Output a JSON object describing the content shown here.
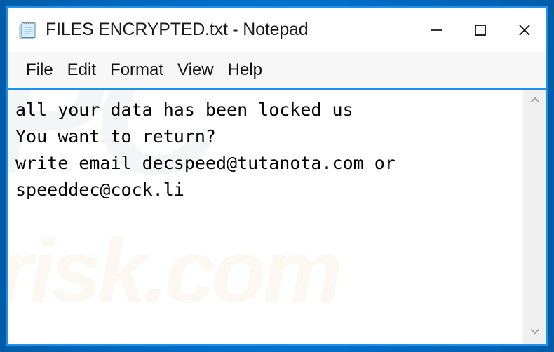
{
  "window": {
    "title": "FILES ENCRYPTED.txt - Notepad",
    "app_icon": "notepad-icon",
    "frame_color": "#0066bb",
    "frame_inner_color": "#1d92e8",
    "background_color": "#ffffff"
  },
  "title_bar": {
    "minimize_label": "—",
    "maximize_label": "□",
    "close_label": "✕",
    "minimize_name": "minimize-icon",
    "maximize_name": "maximize-icon",
    "close_name": "close-icon"
  },
  "menu_bar": {
    "items": [
      {
        "label": "File"
      },
      {
        "label": "Edit"
      },
      {
        "label": "Format"
      },
      {
        "label": "View"
      },
      {
        "label": "Help"
      }
    ],
    "background_color": "#f7f7f7",
    "underline_color": "#1d92e8"
  },
  "editor": {
    "text": "all your data has been locked us\nYou want to return?\nwrite email decspeed@tutanota.com or\nspeeddec@cock.li",
    "lines": [
      "all your data has been locked us",
      "You want to return?",
      "write email decspeed@tutanota.com or",
      "speeddec@cock.li"
    ],
    "text_color": "#000000",
    "background_color": "#ffffff",
    "contacts": [
      "decspeed@tutanota.com",
      "speeddec@cock.li"
    ]
  },
  "watermark": {
    "mark_text": "PC",
    "domain_text": "risk.com",
    "mark_color": "#f4f5f7",
    "domain_color": "#fdf7f2"
  },
  "scrollbar": {
    "up_arrow": "⌃",
    "down_arrow": "⌄",
    "track_color": "#f0f0f0",
    "arrow_color": "#a0a0a0"
  }
}
